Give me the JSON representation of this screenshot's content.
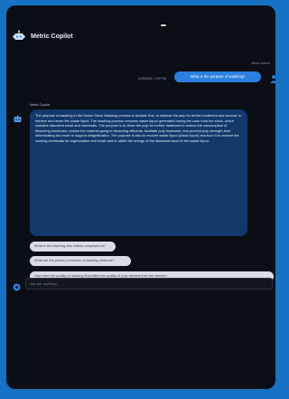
{
  "app": {
    "title": "Metric Copilot"
  },
  "conversation": {
    "user": {
      "name": "Metric Admin",
      "timestamp": "1/29/2024, 7:09 PM",
      "message": "What is the purpose of washing?"
    },
    "bot": {
      "name": "Metric Copilot",
      "message": "The purpose of washing in the Brown Stock Washing process is twofold: first, to cleanse the pulp for further treatment and second, to retrieve and reuse the waste liquid. The washing process removes waste liquor generated during the cook from the stock, which contains dissolved wood and chemicals. The purpose is to clean the pulp for further treatment to reduce the consumption of bleaching chemicals, reduce the material going to bleaching effluents, facilitate pulp treatment, and prevent pulp strength from deteriorating too much to support delignification. The purpose is also to recover waste liquor (black liquor) and burn it to recover the cooking chemicals for regeneration and reuse and to utilize the energy of the dissolved wood in the waste liquor."
    }
  },
  "suggestions": [
    "What is the washing loss mainly comprised of?",
    "What are the primary functions of washing methods?",
    "How does the quality of washing fluid affect the quality of pulp derived from the washer?"
  ],
  "composer": {
    "placeholder": "Ask me anything..."
  },
  "colors": {
    "border_accent": "#1672c4",
    "user_bubble": "#2a7fe0",
    "bot_bubble": "#13396b",
    "background": "#0b0e14",
    "suggestion_chip": "#d9dde3"
  },
  "icons": {
    "app": "bot-icon",
    "user": "user-avatar-icon",
    "bot": "bot-avatar-icon",
    "input": "chat-icon"
  }
}
